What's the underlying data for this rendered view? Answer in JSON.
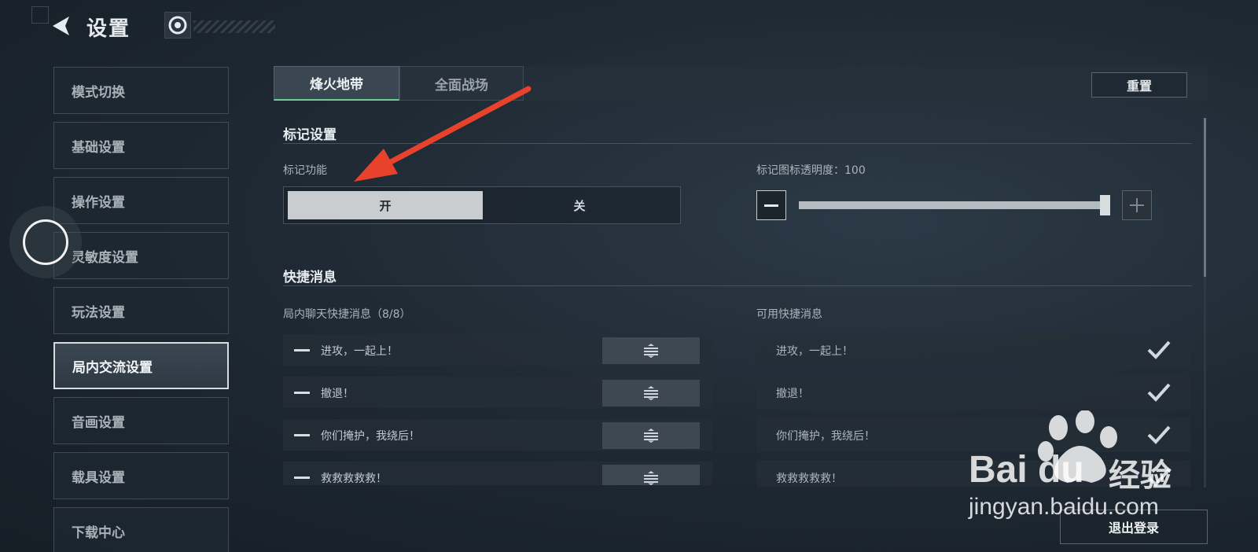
{
  "header": {
    "title": "设置",
    "back_icon": "back-arrow-icon",
    "help_icon": "help-icon"
  },
  "sidebar": {
    "items": [
      {
        "label": "模式切换",
        "active": false
      },
      {
        "label": "基础设置",
        "active": false
      },
      {
        "label": "操作设置",
        "active": false
      },
      {
        "label": "灵敏度设置",
        "active": false
      },
      {
        "label": "玩法设置",
        "active": false
      },
      {
        "label": "局内交流设置",
        "active": true
      },
      {
        "label": "音画设置",
        "active": false
      },
      {
        "label": "载具设置",
        "active": false
      },
      {
        "label": "下载中心",
        "active": false
      }
    ]
  },
  "tabs": [
    {
      "label": "烽火地带",
      "selected": true
    },
    {
      "label": "全面战场",
      "selected": false
    }
  ],
  "reset_label": "重置",
  "marker_section": {
    "title": "标记设置",
    "function_label": "标记功能",
    "toggle_on": "开",
    "toggle_off": "关",
    "toggle_state": "开",
    "opacity_label": "标记图标透明度：100",
    "opacity_value": 100
  },
  "quick_section": {
    "title": "快捷消息",
    "left_label": "局内聊天快捷消息（8/8）",
    "right_label": "可用快捷消息",
    "left_items": [
      "进攻，一起上！",
      "撤退！",
      "你们掩护，我绕后！",
      "救救救救救！"
    ],
    "right_items": [
      "进攻，一起上！",
      "撤退！",
      "你们掩护，我绕后！",
      "救救救救救！"
    ]
  },
  "logout_label": "退出登录",
  "watermark": {
    "brand": "Bai du",
    "cn": "经验",
    "url": "jingyan.baidu.com"
  },
  "colors": {
    "accent_green": "#6fcf97",
    "arrow_red": "#e8412c"
  }
}
